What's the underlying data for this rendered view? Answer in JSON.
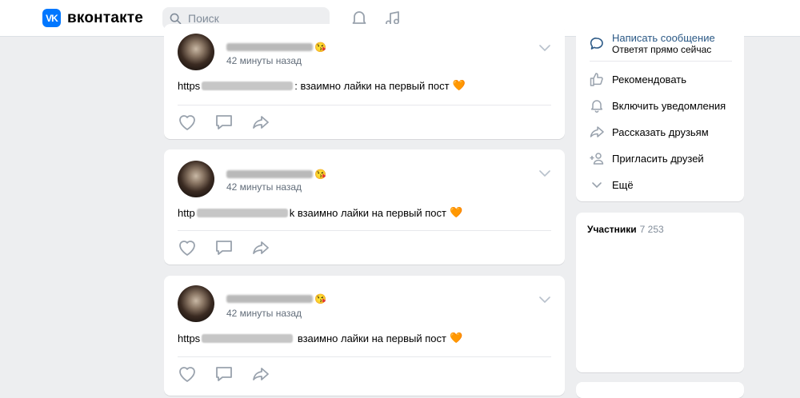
{
  "header": {
    "logo_text": "вконтакте",
    "search_placeholder": "Поиск"
  },
  "posts": [
    {
      "time": "42 минуты назад",
      "url_prefix": "https",
      "url_suffix": ":",
      "text": "взаимно лайки на первый пост",
      "emoji": "🧡"
    },
    {
      "time": "42 минуты назад",
      "url_prefix": "http",
      "url_suffix": "k",
      "text": "взаимно лайки на первый пост",
      "emoji": "🧡"
    },
    {
      "time": "42 минуты назад",
      "url_prefix": "https",
      "url_suffix": "",
      "text": "взаимно лайки на первый пост",
      "emoji": "🧡"
    }
  ],
  "sidebar": {
    "message_title": "Написать сообщение",
    "message_sub": "Ответят прямо сейчас",
    "items": [
      {
        "label": "Рекомендовать",
        "icon": "thumbs-up-icon"
      },
      {
        "label": "Включить уведомления",
        "icon": "bell-icon"
      },
      {
        "label": "Рассказать друзьям",
        "icon": "share-icon"
      },
      {
        "label": "Пригласить друзей",
        "icon": "add-user-icon"
      },
      {
        "label": "Ещё",
        "icon": "chevron-down-icon"
      }
    ],
    "participants_label": "Участники",
    "participants_count": "7 253"
  },
  "colors": {
    "background": "#edeef0",
    "accent": "#0077ff",
    "link": "#2a5885",
    "icon": "#99a2ad"
  }
}
